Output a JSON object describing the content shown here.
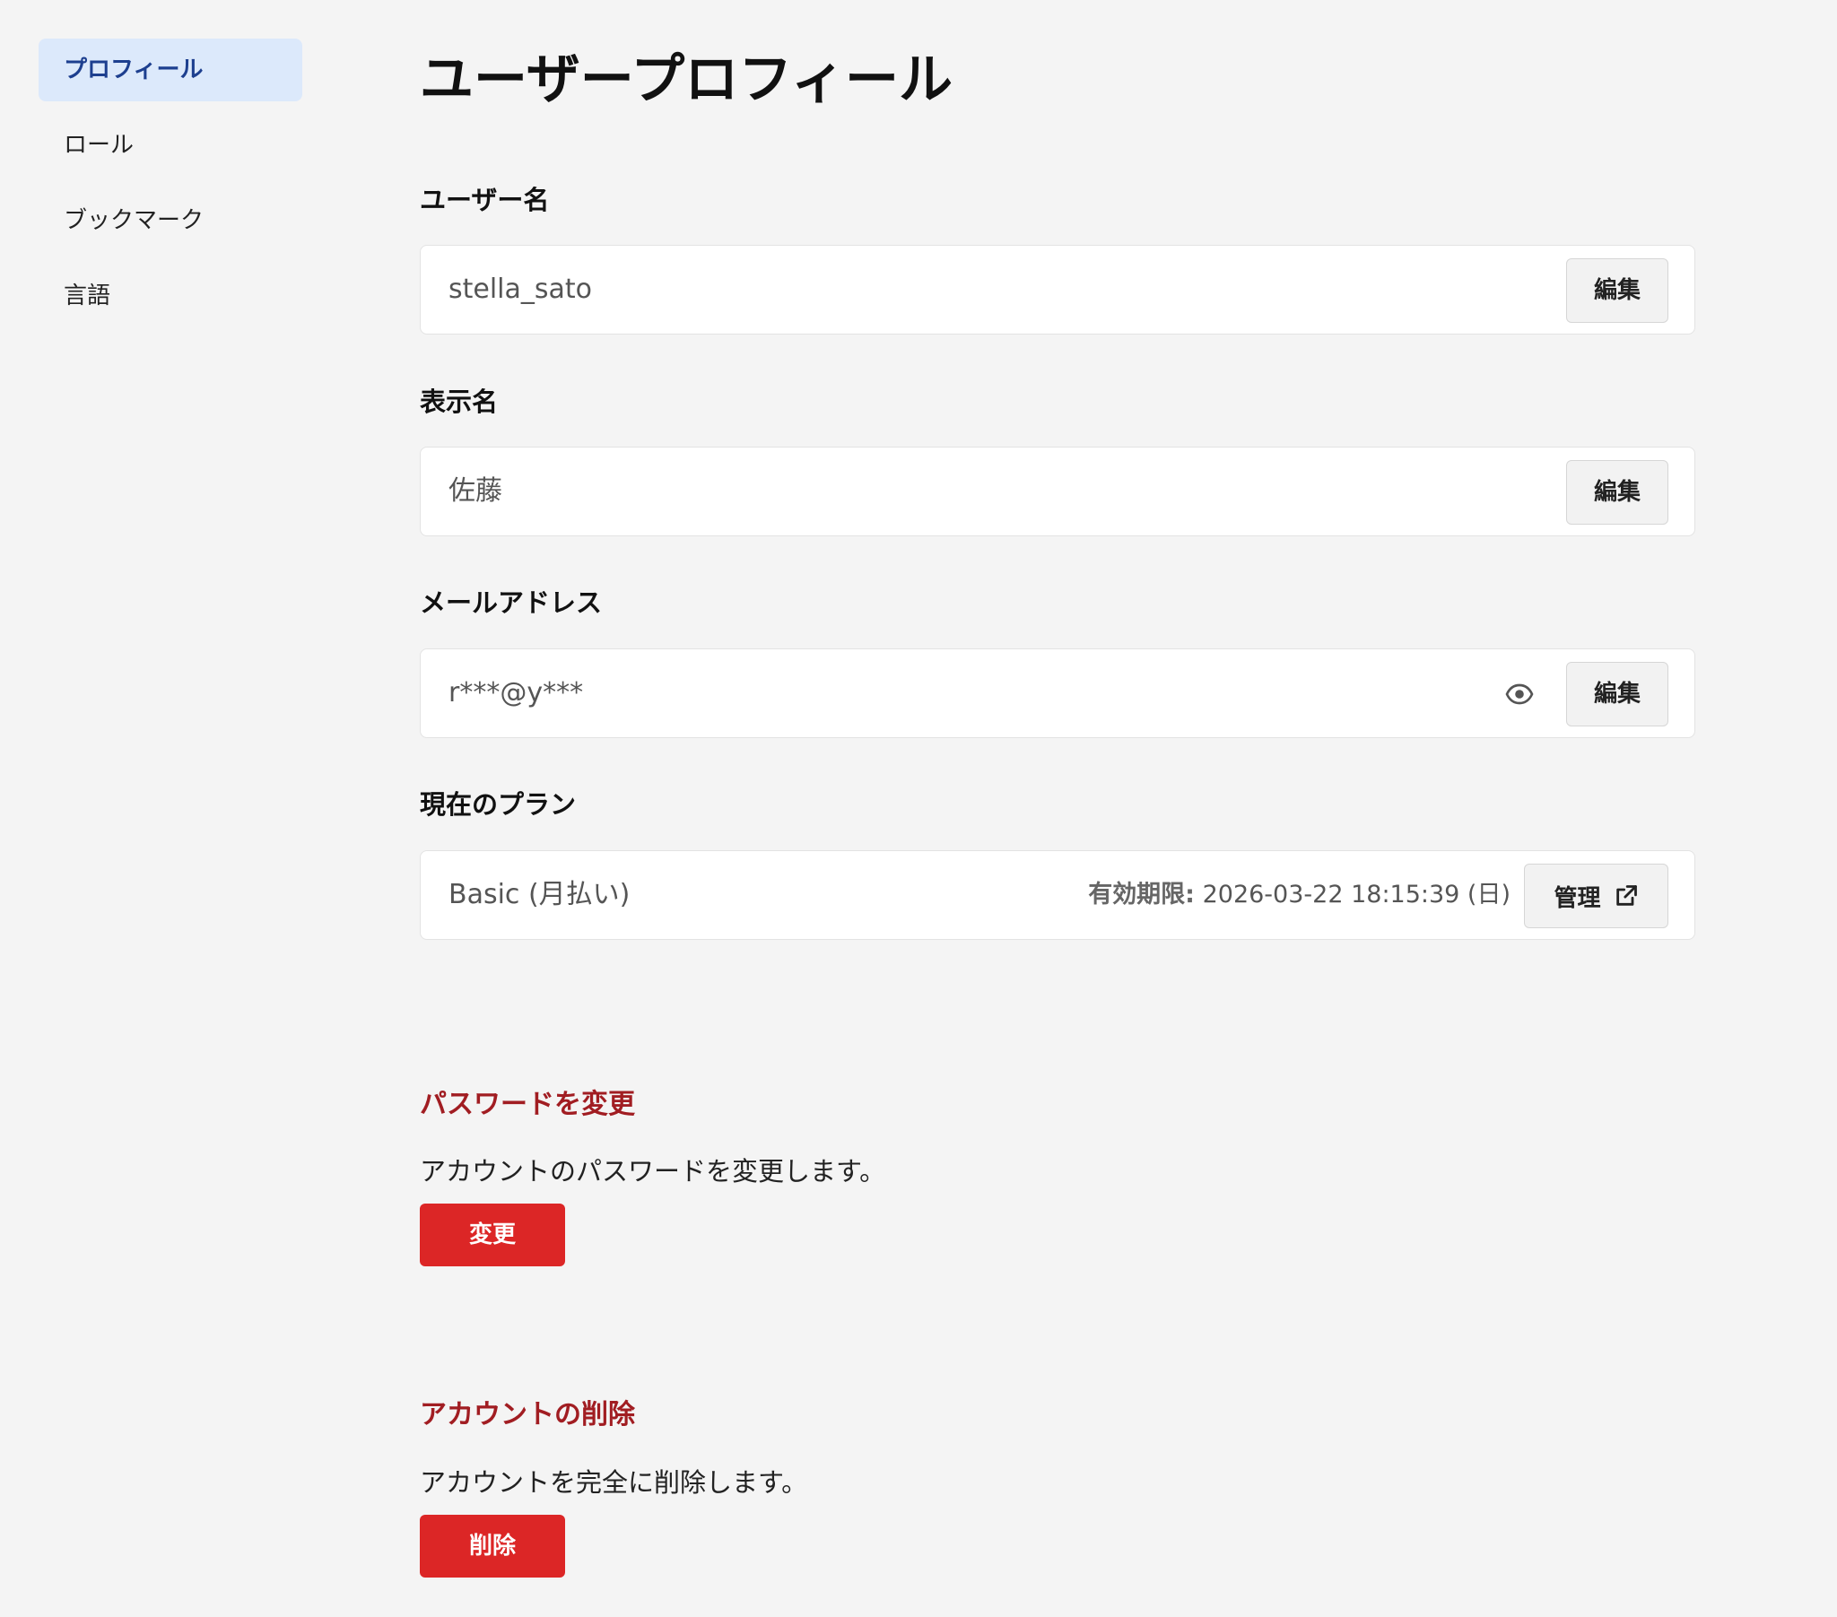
{
  "sidebar": {
    "items": [
      {
        "label": "プロフィール",
        "active": true
      },
      {
        "label": "ロール"
      },
      {
        "label": "ブックマーク"
      },
      {
        "label": "言語"
      }
    ]
  },
  "page": {
    "title": "ユーザープロフィール"
  },
  "fields": {
    "username": {
      "label": "ユーザー名",
      "value": "stella_sato",
      "button": "編集"
    },
    "display_name": {
      "label": "表示名",
      "value": "佐藤",
      "button": "編集"
    },
    "email": {
      "label": "メールアドレス",
      "value": "r***@y***",
      "button": "編集",
      "icon": "eye-icon"
    },
    "plan": {
      "label": "現在のプラン",
      "value": "Basic (月払い)",
      "expiry_label": "有効期限:",
      "expiry_value": "2026-03-22 18:15:39 (日)",
      "button": "管理",
      "icon": "external-link-icon"
    }
  },
  "password": {
    "title": "パスワードを変更",
    "description": "アカウントのパスワードを変更します。",
    "button": "変更"
  },
  "delete_account": {
    "title": "アカウントの削除",
    "description": "アカウントを完全に削除します。",
    "button": "削除"
  },
  "colors": {
    "accent": "#1d3f8f",
    "active_bg": "#dce9fb",
    "danger": "#dc2626",
    "danger_text": "#a11d22"
  }
}
